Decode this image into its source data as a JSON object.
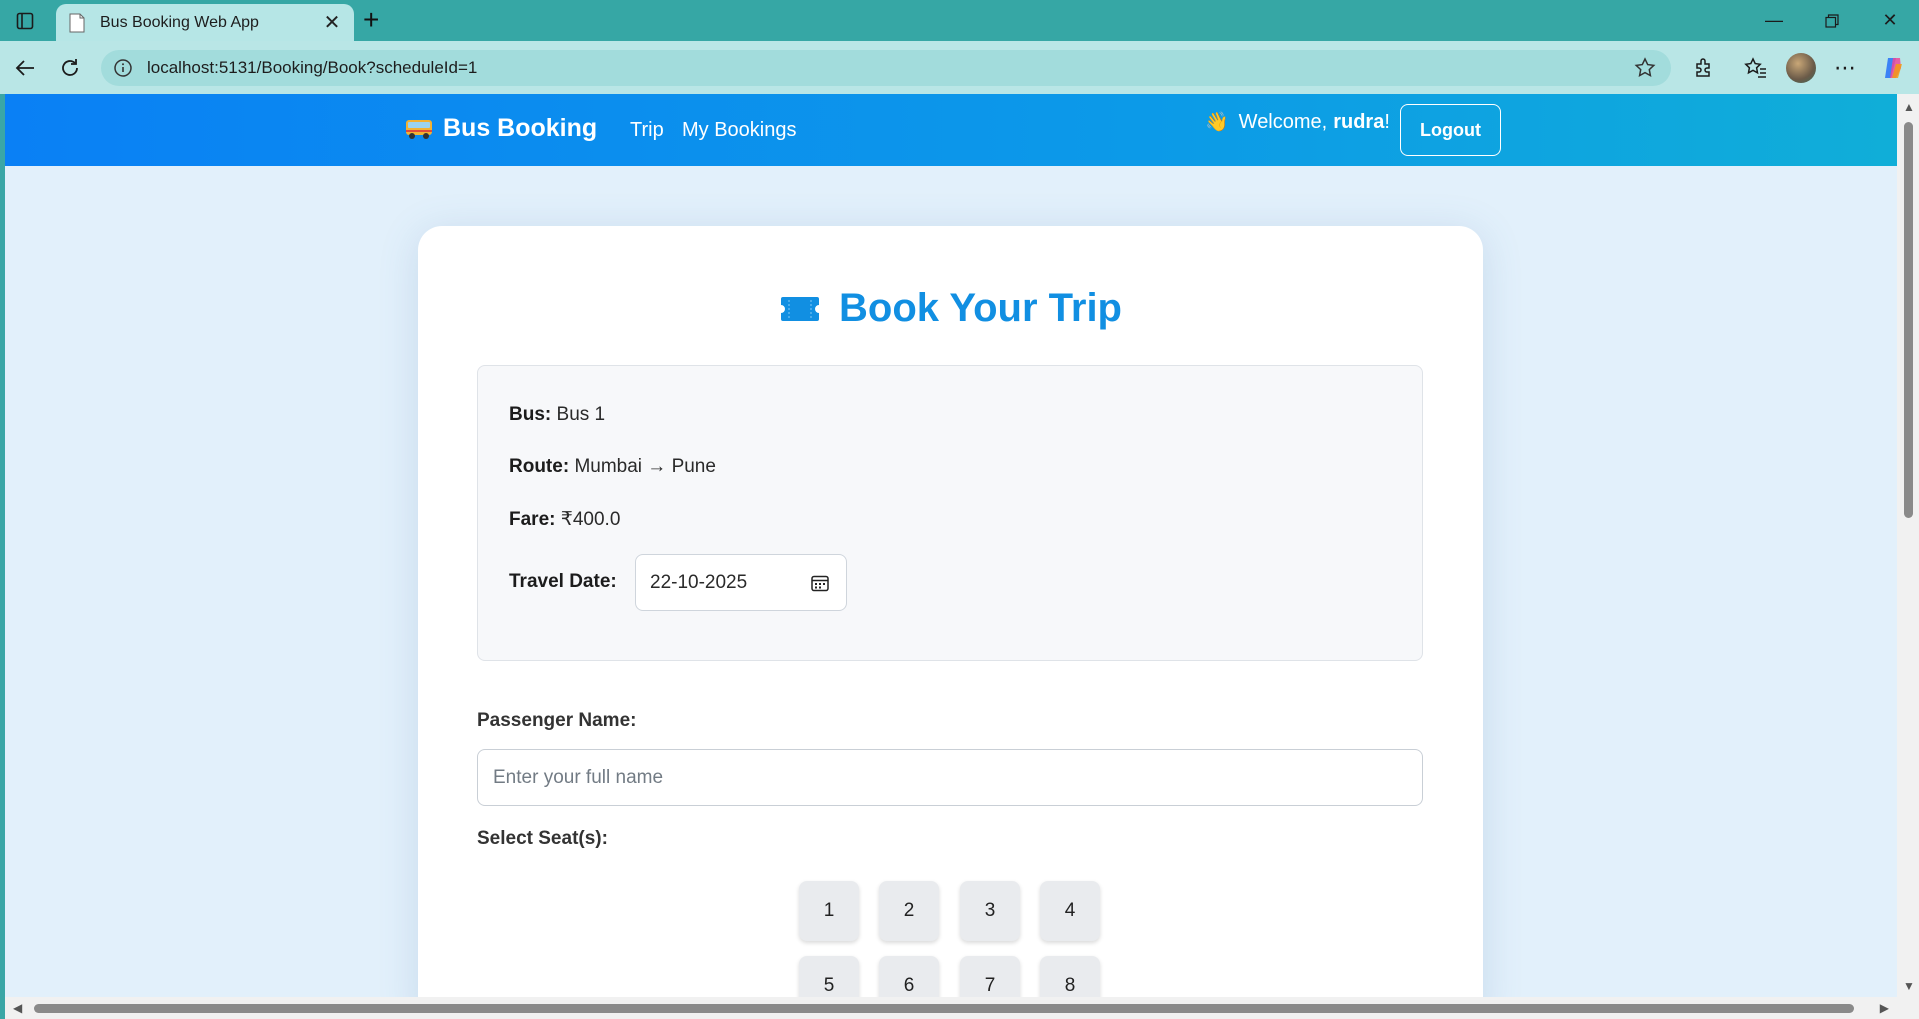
{
  "browser": {
    "tab_title": "Bus Booking Web App",
    "url": "localhost:5131/Booking/Book?scheduleId=1"
  },
  "site": {
    "brand": "Bus Booking",
    "brand_icon": "bus-icon",
    "nav": [
      {
        "label": "Trip"
      },
      {
        "label": "My Bookings"
      }
    ],
    "welcome_prefix": "Welcome,",
    "username": "rudra",
    "welcome_suffix": "!",
    "logout_label": "Logout"
  },
  "booking": {
    "title": "Book Your Trip",
    "title_icon": "ticket-icon",
    "bus_label": "Bus:",
    "bus_value": "Bus 1",
    "route_label": "Route:",
    "route_value": "Mumbai → Pune",
    "fare_label": "Fare:",
    "fare_value": "₹400.0",
    "travel_date_label": "Travel Date:",
    "travel_date_value": "22-10-2025",
    "passenger_label": "Passenger Name:",
    "passenger_placeholder": "Enter your full name",
    "seats_label": "Select Seat(s):",
    "seats": [
      "1",
      "2",
      "3",
      "4",
      "5",
      "6",
      "7",
      "8"
    ]
  },
  "colors": {
    "accent": "#118fe2",
    "nav_gradient_start": "#0a80f5",
    "nav_gradient_end": "#10aed8",
    "browser_frame": "#36a7a5"
  }
}
